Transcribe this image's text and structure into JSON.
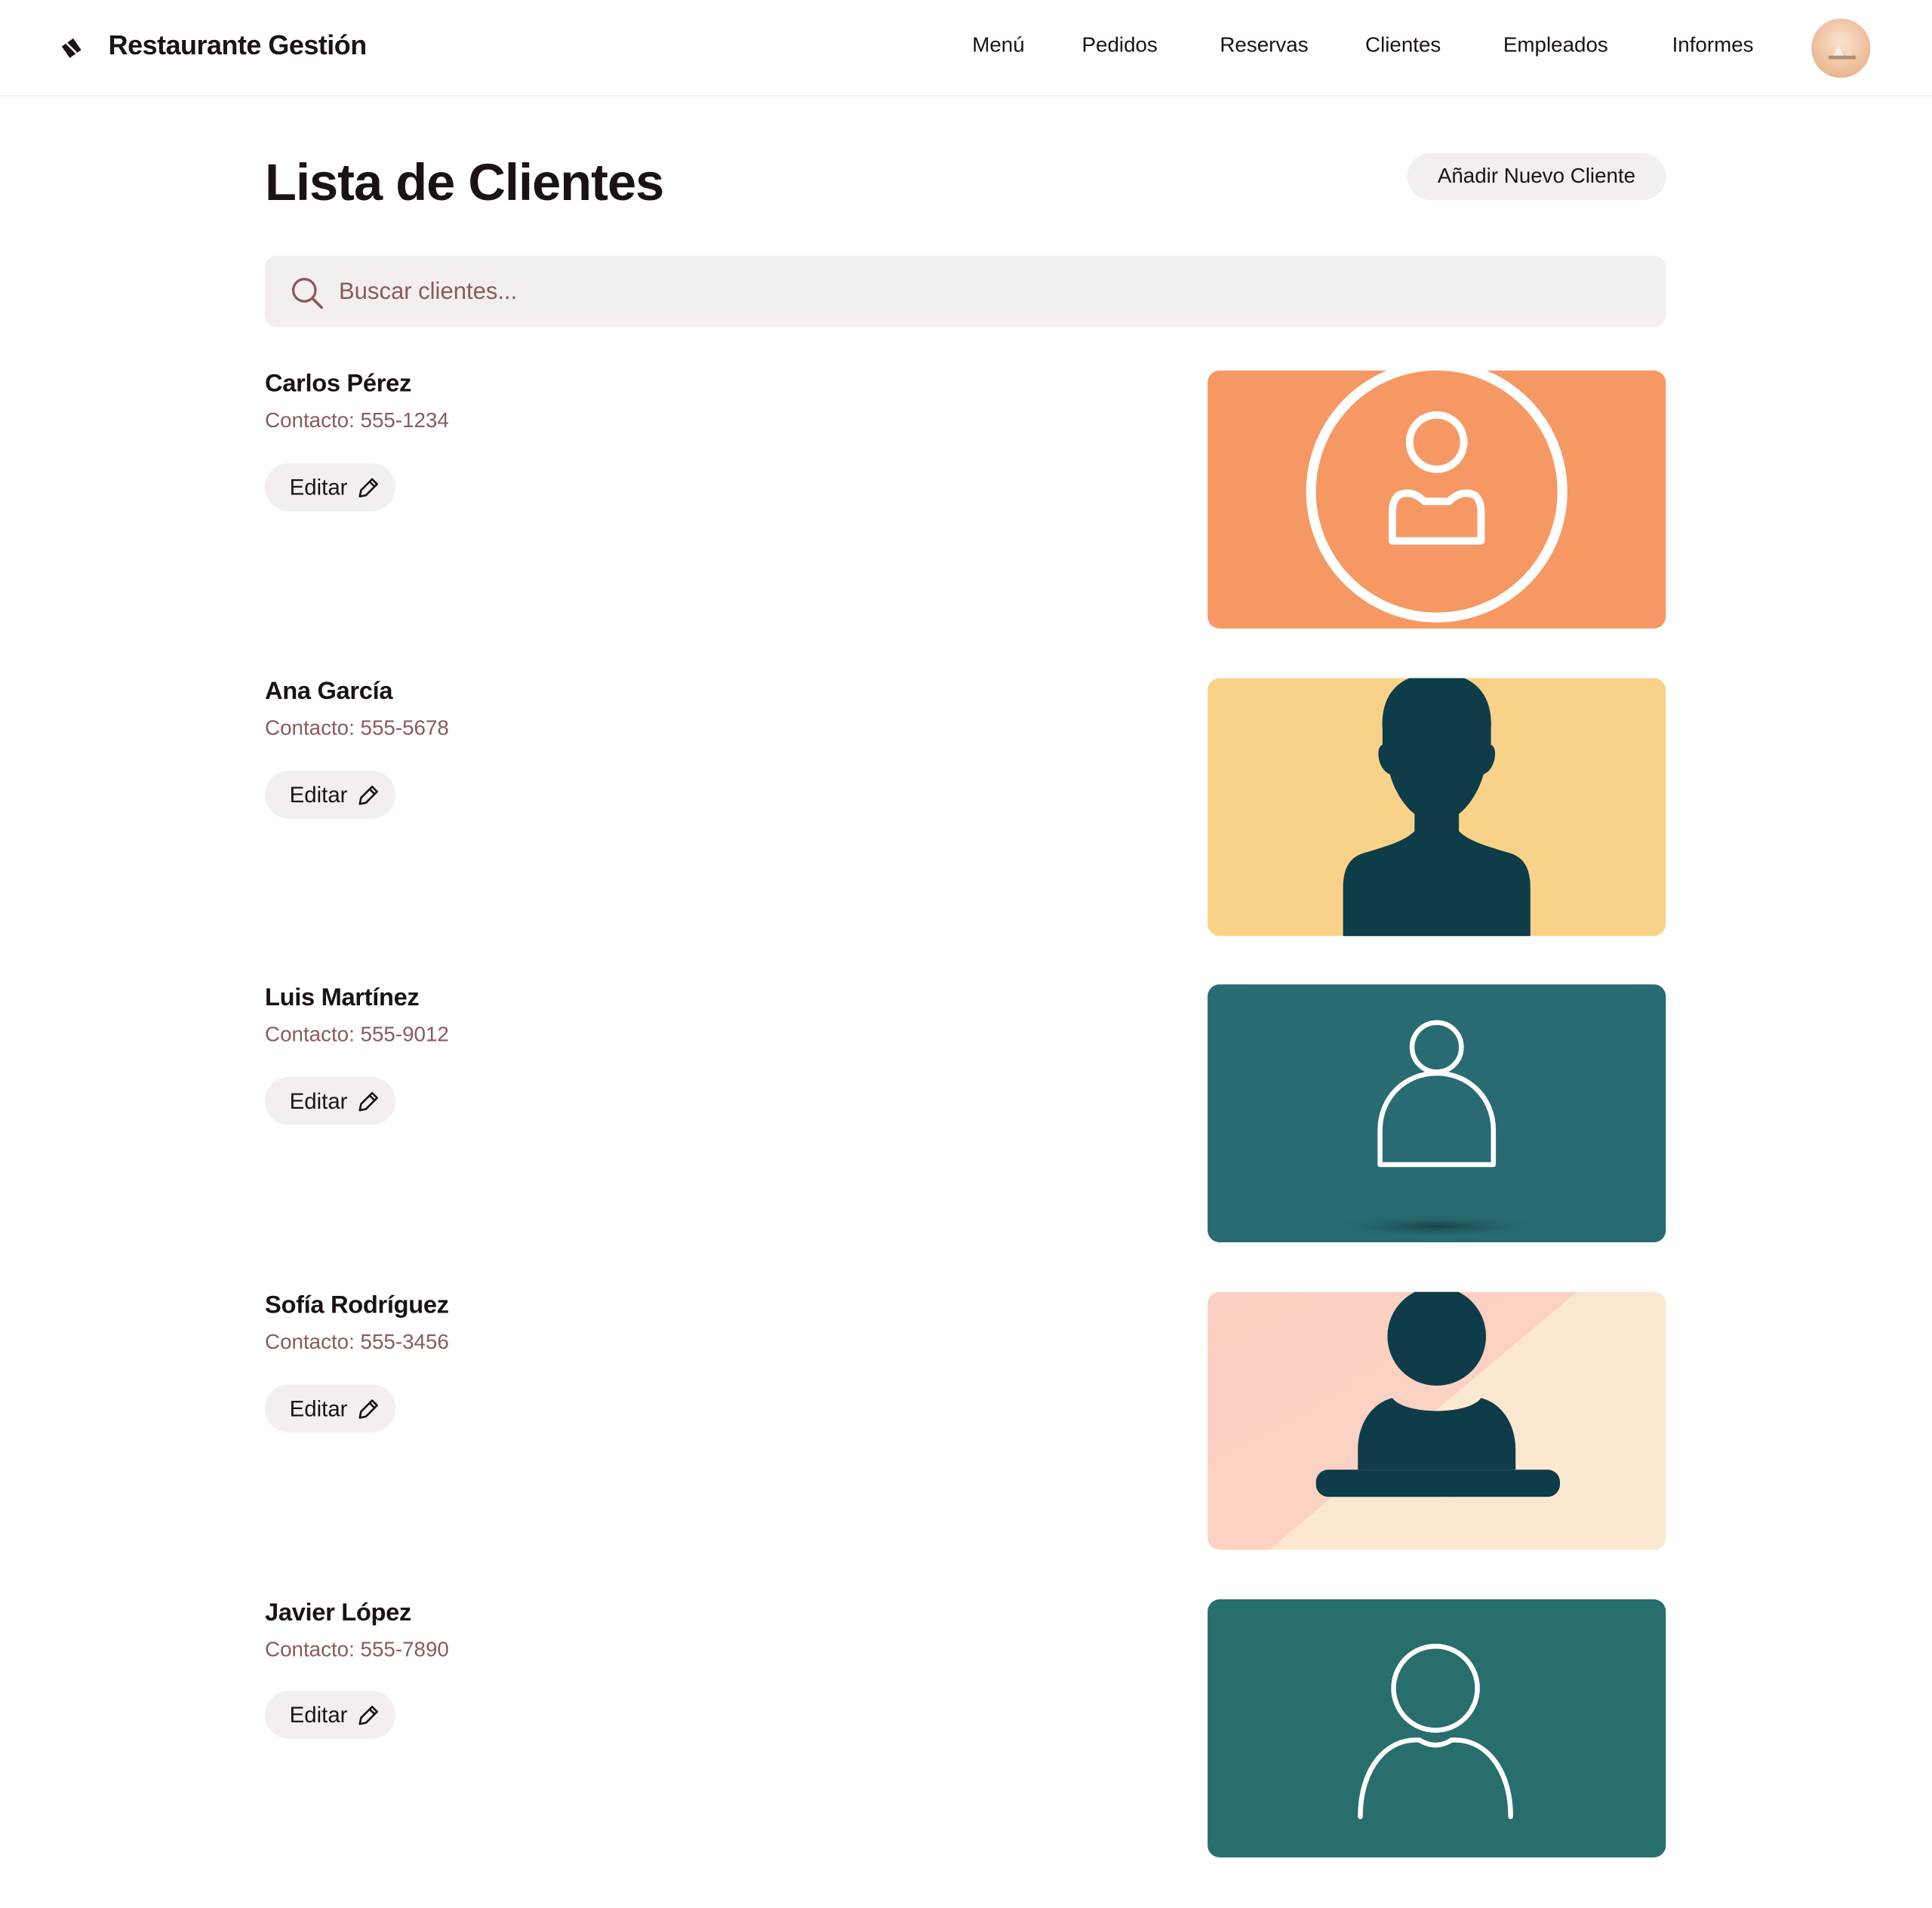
{
  "app": {
    "brand": "Restaurante Gestión"
  },
  "nav": {
    "items": [
      "Menú",
      "Pedidos",
      "Reservas",
      "Clientes",
      "Empleados",
      "Informes"
    ]
  },
  "page": {
    "title": "Lista de Clientes",
    "add_button_label": "Añadir Nuevo Cliente"
  },
  "search": {
    "placeholder": "Buscar clientes...",
    "value": ""
  },
  "edit_label": "Editar",
  "clients": [
    {
      "name": "Carlos Pérez",
      "contact": "Contacto: 555-1234",
      "image_style": "circle-outline-user",
      "image_bg": "#F69864"
    },
    {
      "name": "Ana García",
      "contact": "Contacto: 555-5678",
      "image_style": "silhouette-bust",
      "image_bg": "#F8D288"
    },
    {
      "name": "Luis Martínez",
      "contact": "Contacto: 555-9012",
      "image_style": "outline-user",
      "image_bg": "#296B72"
    },
    {
      "name": "Sofía Rodríguez",
      "contact": "Contacto: 555-3456",
      "image_style": "user-at-desk",
      "image_bg": "#FBCFC1"
    },
    {
      "name": "Javier López",
      "contact": "Contacto: 555-7890",
      "image_style": "outline-user-wide",
      "image_bg": "#276E6C"
    }
  ],
  "colors": {
    "accent_text": "#8A5A5C",
    "button_bg": "#F3EFEE",
    "dark_figure": "#0E3C49"
  }
}
